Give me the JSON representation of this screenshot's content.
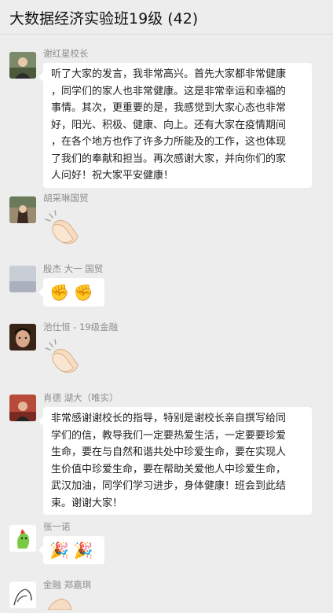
{
  "chat": {
    "title": "大数据经济实验班19级 (42)"
  },
  "messages": [
    {
      "sender": "谢红星校长",
      "lines": [
        "听了大家的发言，我非常高兴。首先大家都非常健康",
        "，同学们的家人也非常健康。这是非常幸运和幸福的",
        "事情。其次，更重要的是，我感觉到大家心态也非常",
        "好，阳光、积极、健康、向上。还有大家在疫情期间",
        "，在各个地方也作了许多力所能及的工作，这也体现",
        "了我们的奉献和担当。再次感谢大家，并向你们的家",
        "人问好！祝大家平安健康！"
      ]
    },
    {
      "sender": "胡采琳国贸",
      "sticker": "clapping-hands-sticker"
    },
    {
      "sender": "殷杰  大一  国贸",
      "emoji": [
        "✊",
        "✊"
      ]
    },
    {
      "sender": "池仕恒 - 19级金融",
      "sticker": "clapping-hands-sticker"
    },
    {
      "sender": "肖德  湖大（唯实）",
      "lines": [
        "非常感谢谢校长的指导，特别是谢校长亲自撰写给同",
        "学们的信，教导我们一定要热爱生活，一定要要珍爱",
        "生命，要在与自然和谐共处中珍爱生命，要在实现人",
        "生价值中珍爱生命，要在帮助关爱他人中珍爱生命，",
        "武汉加油，同学们学习进步，身体健康！班会到此结",
        "束。谢谢大家！"
      ]
    },
    {
      "sender": "张一诺",
      "emoji": [
        "🎉",
        "🎉"
      ]
    },
    {
      "sender": "金融  郑嘉琪"
    }
  ],
  "colors": {
    "background": "#ededed",
    "bubble": "#ffffff",
    "sender_name": "#8c8c8c"
  }
}
